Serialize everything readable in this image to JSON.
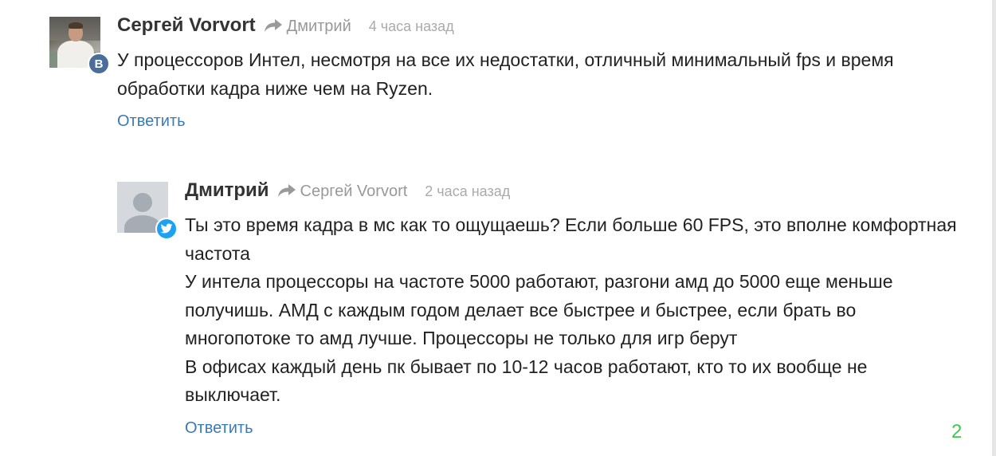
{
  "comments": [
    {
      "author": "Сергей Vorvort",
      "reply_to": "Дмитрий",
      "time": "4 часа назад",
      "avatar": "user-photo",
      "network_badge": "vk",
      "network_badge_label": "B",
      "network_badge_color": "#4a6d9a",
      "lines": [
        "У процессоров Интел, несмотря на все их недостатки, отличный минимальный fps и время обработки кадра ниже чем на Ryzen."
      ],
      "reply_label": "Ответить"
    },
    {
      "author": "Дмитрий",
      "reply_to": "Сергей Vorvort",
      "time": "2 часа назад",
      "avatar": "default-user",
      "network_badge": "twitter",
      "network_badge_color": "#1da1f2",
      "lines": [
        "Ты это время кадра в мс как то ощущаешь? Если больше 60 FPS, это вполне комфортная частота",
        "У интела процессоры на частоте 5000 работают, разгони амд до 5000 еще меньше получишь. АМД с каждым годом делает все быстрее и быстрее, если брать во многопотоке то амд лучше. Процессоры не только для игр берут",
        "В офисах каждый день пк бывает по 10-12 часов работают, кто то их вообще не выключает."
      ],
      "reply_label": "Ответить"
    }
  ],
  "page_number": "2",
  "colors": {
    "link": "#3a7ab8",
    "muted": "#999999",
    "page_number": "#3ccb4a"
  }
}
